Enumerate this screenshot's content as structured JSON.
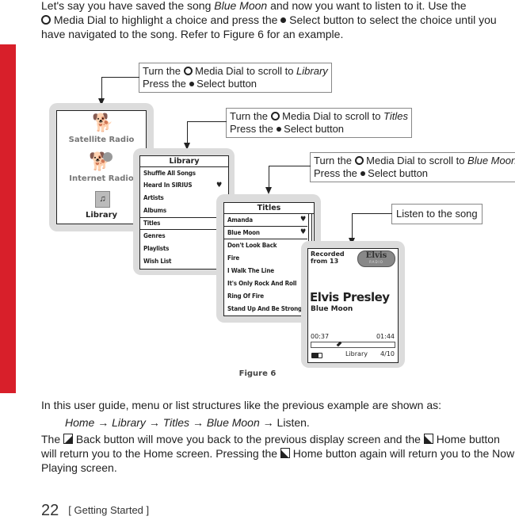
{
  "intro": {
    "text_a": "Let's say you have saved the song ",
    "song": "Blue Moon",
    "text_b": " and now you want to listen to it. Use the",
    "text_c": " Media Dial to highlight a choice and press the ",
    "text_d": " Select button to select the choice until you have navigated to the song. Refer to Figure 6 for an example."
  },
  "callouts": [
    {
      "line1_pre": "Turn the ",
      "line1_mid": " Media Dial to scroll to ",
      "target": "Library",
      "line2_pre": "Press the ",
      "line2_post": " Select button"
    },
    {
      "line1_pre": "Turn the ",
      "line1_mid": " Media Dial to scroll to ",
      "target": "Titles",
      "line2_pre": "Press the ",
      "line2_post": " Select button"
    },
    {
      "line1_pre": "Turn the ",
      "line1_mid": " Media Dial to scroll to ",
      "target": "Blue Moon",
      "line2_pre": "Press the ",
      "line2_post": " Select button"
    },
    {
      "text": "Listen to the song"
    }
  ],
  "home_screen": {
    "items": [
      "Satellite Radio",
      "Internet Radio",
      "Library"
    ],
    "selected": "Library"
  },
  "library_screen": {
    "title": "Library",
    "items": [
      {
        "label": "Shuffle All Songs",
        "heart": false
      },
      {
        "label": "Heard In SIRIUS",
        "heart": true
      },
      {
        "label": "Artists",
        "heart": false
      },
      {
        "label": "Albums",
        "heart": false
      },
      {
        "label": "Titles",
        "heart": false
      },
      {
        "label": "Genres",
        "heart": false
      },
      {
        "label": "Playlists",
        "heart": false
      },
      {
        "label": "Wish List",
        "heart": false
      }
    ],
    "selected_index": 4
  },
  "titles_screen": {
    "title": "Titles",
    "items": [
      {
        "label": "Amanda",
        "heart": true
      },
      {
        "label": "Blue Moon",
        "heart": true
      },
      {
        "label": "Don't Look Back",
        "heart": false
      },
      {
        "label": "Fire",
        "heart": false
      },
      {
        "label": "I Walk The Line",
        "heart": false
      },
      {
        "label": "It's Only Rock And Roll",
        "heart": false
      },
      {
        "label": "Ring Of Fire",
        "heart": false
      },
      {
        "label": "Stand Up And Be Strong",
        "heart": false
      }
    ],
    "selected_index": 1
  },
  "now_playing": {
    "recorded_line1": "Recorded",
    "recorded_line2": "from 13",
    "channel_logo": "Elvis",
    "channel_logo_sub": "RADIO",
    "artist": "Elvis Presley",
    "song": "Blue Moon",
    "elapsed": "00:37",
    "total": "01:44",
    "progress": 0.33,
    "source": "Library",
    "position": "4/10"
  },
  "figure_caption": "Figure 6",
  "para2": "In this user guide, menu or list structures like the previous example are shown as:",
  "path": {
    "steps": [
      "Home",
      "Library",
      "Titles",
      "Blue Moon"
    ],
    "arrow": "→",
    "last": "Listen."
  },
  "para4": {
    "a": "The ",
    "b": " Back button will move you back to the previous display screen and the ",
    "c": " Home button will return you to the Home screen. Pressing the ",
    "d": " Home button again will return you to the Now Playing screen."
  },
  "footer": {
    "page_number": "22",
    "section": "[ Getting Started ]"
  },
  "colors": {
    "accent_red": "#d81f2a",
    "device_gray": "#dcdcdc"
  }
}
